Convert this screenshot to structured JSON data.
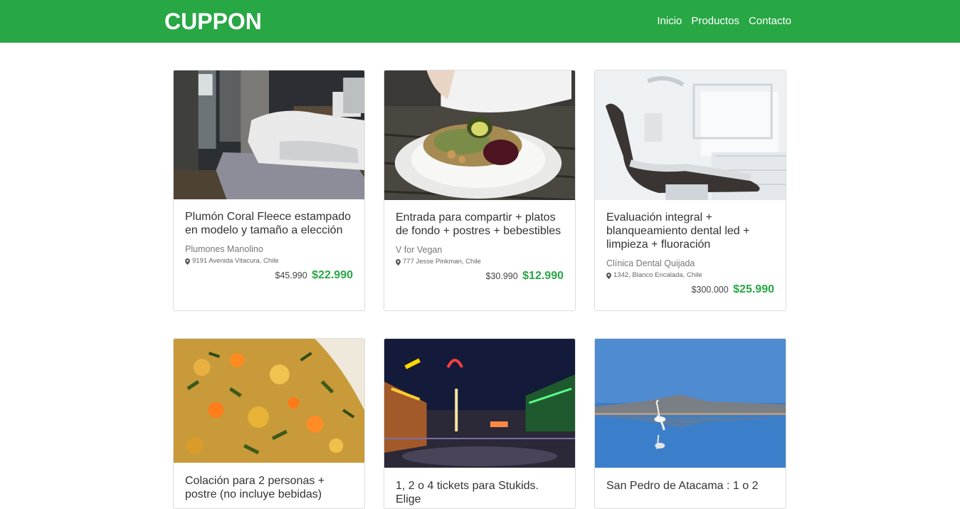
{
  "brand": "CUPPON",
  "nav": [
    "Inicio",
    "Productos",
    "Contacto"
  ],
  "accent_color": "#28a745",
  "cards": [
    {
      "image": "bedroom-photo",
      "title": "Plumón Coral Fleece estampado en modelo y tamaño a elección",
      "provider": "Plumones Manolino",
      "address": "9191 Avenida Vitacura, Chile",
      "old_price": "$45.990",
      "new_price": "$22.990"
    },
    {
      "image": "vegan-plate-photo",
      "title": "Entrada para compartir + platos de fondo + postres + bebestibles",
      "provider": "V for Vegan",
      "address": "777 Jesse Pinkman, Chile",
      "old_price": "$30.990",
      "new_price": "$12.990"
    },
    {
      "image": "dental-chair-photo",
      "title": "Evaluación integral + blanqueamiento dental led + limpieza + fluoración",
      "provider": "Clínica Dental Quijada",
      "address": "1342, Blanco Encalada, Chile",
      "old_price": "$300.000",
      "new_price": "$25.990"
    },
    {
      "image": "food-dish-photo",
      "title": "Colación para 2 personas + postre (no incluye bebidas)"
    },
    {
      "image": "fair-night-photo",
      "title": "1, 2 o 4 tickets para Stukids. Elige"
    },
    {
      "image": "flamingo-lake-photo",
      "title": "San Pedro de Atacama : 1 o 2"
    }
  ]
}
